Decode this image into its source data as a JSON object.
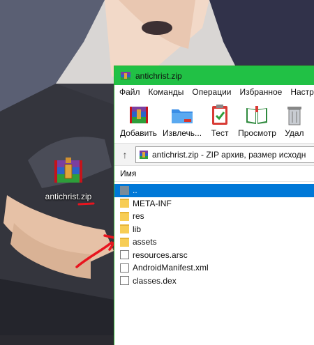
{
  "desktop": {
    "icon_label": "antichrist.zip"
  },
  "window": {
    "title": "antichrist.zip",
    "menu": [
      "Файл",
      "Команды",
      "Операции",
      "Избранное",
      "Настр"
    ],
    "toolbar": [
      {
        "label": "Добавить",
        "icon": "winrar-add-icon"
      },
      {
        "label": "Извлечь...",
        "icon": "extract-folder-icon"
      },
      {
        "label": "Тест",
        "icon": "test-clipboard-icon"
      },
      {
        "label": "Просмотр",
        "icon": "view-book-icon"
      },
      {
        "label": "Удал",
        "icon": "delete-trash-icon"
      }
    ],
    "address": "antichrist.zip - ZIP архив, размер исходн",
    "column_name": "Имя",
    "files": [
      {
        "name": "..",
        "type": "up",
        "selected": true
      },
      {
        "name": "META-INF",
        "type": "folder"
      },
      {
        "name": "res",
        "type": "folder"
      },
      {
        "name": "lib",
        "type": "folder"
      },
      {
        "name": "assets",
        "type": "folder"
      },
      {
        "name": "resources.arsc",
        "type": "file"
      },
      {
        "name": "AndroidManifest.xml",
        "type": "file"
      },
      {
        "name": "classes.dex",
        "type": "file"
      }
    ]
  },
  "colors": {
    "titlebar": "#21c145",
    "selection": "#0078d7",
    "folder": "#f7cd55",
    "annotation": "#e8141e"
  }
}
